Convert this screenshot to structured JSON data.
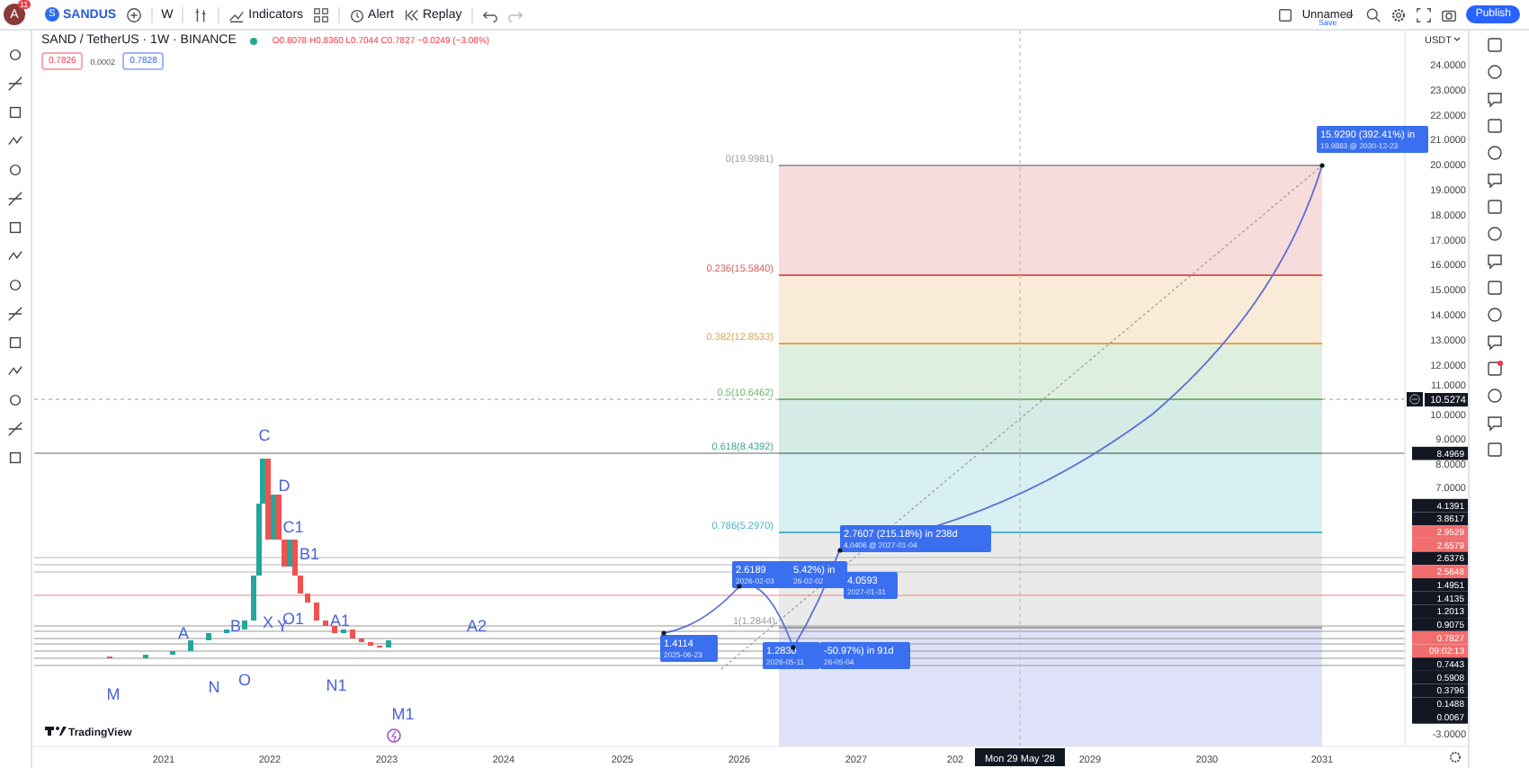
{
  "top_bar": {
    "avatar": "A",
    "notification_count": "11",
    "symbol_logo": "S",
    "symbol": "SANDUS",
    "interval": "W",
    "indicators": "Indicators",
    "alert": "Alert",
    "replay": "Replay",
    "layout_name": "Unnamed",
    "save": "Save",
    "publish": "Publish"
  },
  "legend": {
    "title": "SAND / TetherUS · 1W · BINANCE",
    "open": "O0.8078",
    "high": "H0.8360",
    "low": "L0.7044",
    "close": "C0.7827",
    "change": "−0.0249 (−3.08%)",
    "sell": "0.7826",
    "spread": "0.0002",
    "buy": "0.7828"
  },
  "fib_levels": [
    {
      "label": "0(19.9981)",
      "color": "#9e9e9e"
    },
    {
      "label": "0.236(15.5840)",
      "color": "#e05a5a"
    },
    {
      "label": "0.382(12.8533)",
      "color": "#e3a348"
    },
    {
      "label": "0.5(10.6462)",
      "color": "#6cb86c"
    },
    {
      "label": "0.618(8.4392)",
      "color": "#3fa58f"
    },
    {
      "label": "0.786(5.2970)",
      "color": "#4fb4c8"
    },
    {
      "label": "1(1.2844)",
      "color": "#9e9e9e"
    }
  ],
  "wave_labels": [
    "A",
    "B",
    "C",
    "D",
    "C1",
    "B1",
    "X",
    "Y",
    "O1",
    "A1",
    "A2",
    "M",
    "N",
    "O",
    "N1",
    "M1"
  ],
  "measure_boxes": [
    {
      "lines": [
        "15.9290 (392.41%) in",
        "19.9883 @ 2030-12-23"
      ]
    },
    {
      "lines": [
        "2.7607 (215.18%) in 238d",
        "4.0406 @ 2027-01-04"
      ]
    },
    {
      "lines": [
        "2.6189",
        "2026-02-03"
      ]
    },
    {
      "lines": [
        "5.42%) in",
        "26-02-02"
      ]
    },
    {
      "lines": [
        "4.0593",
        "2027-01-31"
      ]
    },
    {
      "lines": [
        "1.4114",
        "2025-06-23"
      ]
    },
    {
      "lines": [
        "1.2830",
        "2026-05-11"
      ]
    },
    {
      "lines": [
        "-50.97%) in 91d",
        "26-05-04"
      ]
    }
  ],
  "price_axis": {
    "currency": "USDT",
    "ticks": [
      "24.0000",
      "23.0000",
      "22.0000",
      "21.0000",
      "20.0000",
      "19.0000",
      "18.0000",
      "17.0000",
      "16.0000",
      "15.0000",
      "14.0000",
      "13.0000",
      "12.0000",
      "11.0000",
      "10.0000",
      "9.0000",
      "8.0000",
      "7.0000"
    ],
    "bottom_tick": "-3.0000",
    "crosshair_price": "10.5274",
    "badges": [
      {
        "text": "8.4969",
        "color": "#131722"
      },
      {
        "text": "4.1391",
        "color": "#131722"
      },
      {
        "text": "3.8617",
        "color": "#131722"
      },
      {
        "text": "2.9529",
        "color": "#f26d6d"
      },
      {
        "text": "2.6579",
        "color": "#f26d6d"
      },
      {
        "text": "2.6376",
        "color": "#131722"
      },
      {
        "text": "2.5648",
        "color": "#f26d6d"
      },
      {
        "text": "1.4951",
        "color": "#131722"
      },
      {
        "text": "1.4135",
        "color": "#131722"
      },
      {
        "text": "1.2013",
        "color": "#131722"
      },
      {
        "text": "0.9075",
        "color": "#131722"
      },
      {
        "text": "0.7827",
        "color": "#f26d6d"
      },
      {
        "text": "09:02:13",
        "color": "#f26d6d"
      },
      {
        "text": "0.7443",
        "color": "#131722"
      },
      {
        "text": "0.5908",
        "color": "#131722"
      },
      {
        "text": "0.3796",
        "color": "#131722"
      },
      {
        "text": "0.1488",
        "color": "#131722"
      },
      {
        "text": "0.0067",
        "color": "#131722"
      }
    ]
  },
  "time_axis": {
    "ticks": [
      "2021",
      "2022",
      "2023",
      "2024",
      "2025",
      "2026",
      "2027",
      "202",
      "2029",
      "2030",
      "2031"
    ],
    "cursor_label": "Mon 29 May '28"
  },
  "brand": "TradingView"
}
